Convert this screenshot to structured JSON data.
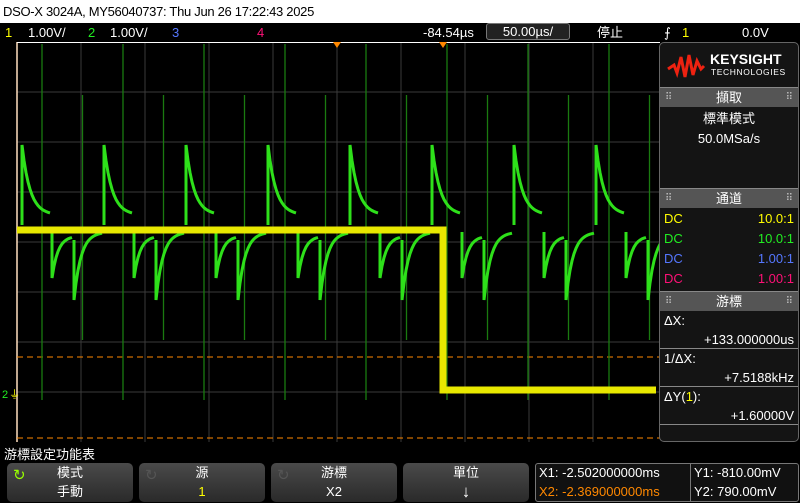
{
  "title": "DSO-X 3024A, MY56040737: Thu Jun 26 17:22:43 2025",
  "status": {
    "ch1_num": "1",
    "ch1_scale": "1.00V/",
    "ch2_num": "2",
    "ch2_scale": "1.00V/",
    "ch3_num": "3",
    "ch4_num": "4",
    "delay": "-84.54µs",
    "timebase": "50.00µs/",
    "run_state": "停止",
    "trigger_icon": "rising-edge-icon",
    "trigger_source": "1",
    "trigger_level": "0.0V"
  },
  "panel": {
    "brand": "KEYSIGHT",
    "brand_sub": "TECHNOLOGIES",
    "acq_header": "擷取",
    "acq_mode": "標準模式",
    "sample_rate": "50.0MSa/s",
    "chan_header": "通道",
    "channels": [
      {
        "coupling": "DC",
        "probe": "10.0:1",
        "color": "#ffff00"
      },
      {
        "coupling": "DC",
        "probe": "10.0:1",
        "color": "#22ee22"
      },
      {
        "coupling": "DC",
        "probe": "1.00:1",
        "color": "#5577ff"
      },
      {
        "coupling": "DC",
        "probe": "1.00:1",
        "color": "#ff1177"
      }
    ],
    "cursor_header": "游標",
    "dx_label": "ΔX:",
    "dx_value": "+133.000000us",
    "inv_dx_label": "1/ΔX:",
    "inv_dx_value": "+7.5188kHz",
    "dy_label_pre": "ΔY(",
    "dy_label_src": "1",
    "dy_label_post": "):",
    "dy_value": "+1.60000V"
  },
  "menu": {
    "title": "游標設定功能表",
    "softkeys": [
      {
        "top": "模式",
        "bottom": "手動"
      },
      {
        "top": "源",
        "bottom": "1"
      },
      {
        "top": "游標",
        "bottom": "X2"
      },
      {
        "top": "單位",
        "bottom": "↓"
      }
    ]
  },
  "cursors": {
    "x1": "X1: -2.502000000ms",
    "x2": "X2: -2.369000000ms",
    "y1": "Y1: -810.00mV",
    "y2": "Y2: 790.00mV"
  },
  "colors": {
    "ch1": "#ffff00",
    "ch2": "#22ee22",
    "cursor": "#ff8800"
  }
}
